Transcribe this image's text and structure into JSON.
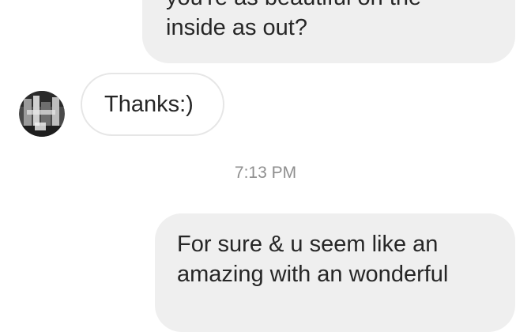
{
  "messages": [
    {
      "direction": "sent",
      "lines": [
        "you're as beautiful on the",
        "inside as out?"
      ]
    },
    {
      "direction": "received",
      "text": "Thanks:)"
    },
    {
      "direction": "sent",
      "lines": [
        "For sure & u seem like an",
        "amazing with an wonderful"
      ]
    }
  ],
  "timestamp": "7:13 PM",
  "colors": {
    "sent_bubble": "#efefef",
    "received_border": "#e6e6e6",
    "message_text": "#262626",
    "timestamp_text": "#8e8e8e"
  },
  "icons": {
    "avatar": "user-avatar-photo"
  }
}
